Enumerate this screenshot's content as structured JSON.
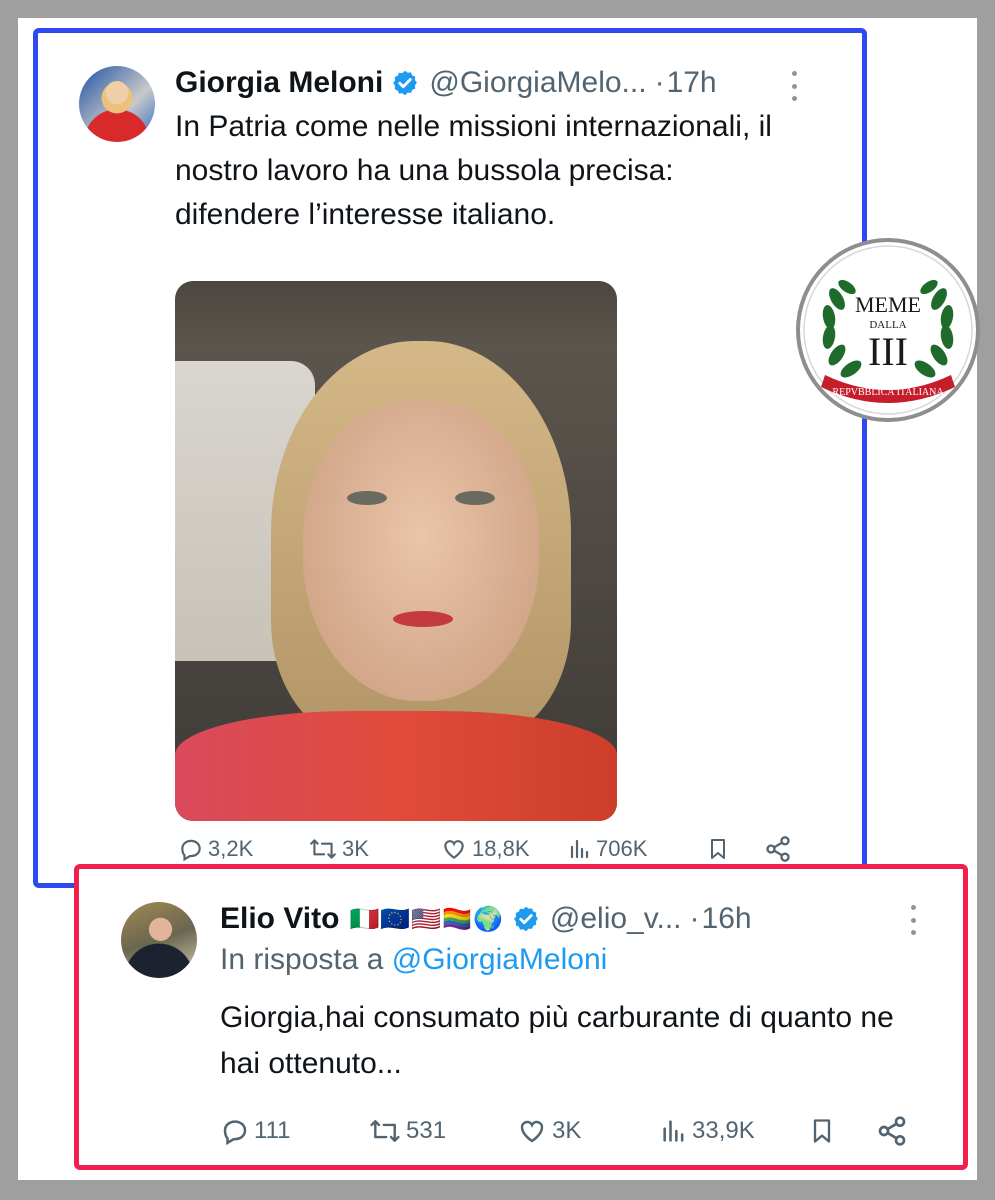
{
  "main_tweet": {
    "name": "Giorgia Meloni",
    "handle": "@GiorgiaMelo...",
    "separator": "·",
    "time": "17h",
    "text": "In Patria come nelle missioni internazionali, il nostro lavoro ha una bussola precisa: difendere l’interesse italiano.",
    "stats": {
      "replies": "3,2K",
      "retweets": "3K",
      "likes": "18,8K",
      "views": "706K"
    }
  },
  "reply_tweet": {
    "name": "Elio Vito",
    "flags": "🇮🇹🇪🇺🇺🇸🏳️‍🌈🌍",
    "handle": "@elio_v...",
    "separator": "·",
    "time": "16h",
    "reply_prefix": "In risposta a",
    "reply_mention": "@GiorgiaMeloni",
    "text": "Giorgia,hai consumato più carburante di quanto ne hai ottenuto...",
    "stats": {
      "replies": "111",
      "retweets": "531",
      "likes": "3K",
      "views": "33,9K"
    }
  },
  "logo": {
    "line1": "MEME",
    "line2": "DALLA",
    "line3": "III",
    "ribbon": "REPVBBLICA ITALIANA"
  },
  "colors": {
    "main_border": "#2f49f0",
    "reply_border": "#ef1f4e",
    "verified": "#1d9bf0",
    "mention": "#1d9bf0",
    "logo_green": "#1f6b2c",
    "logo_red": "#c61d2c"
  }
}
